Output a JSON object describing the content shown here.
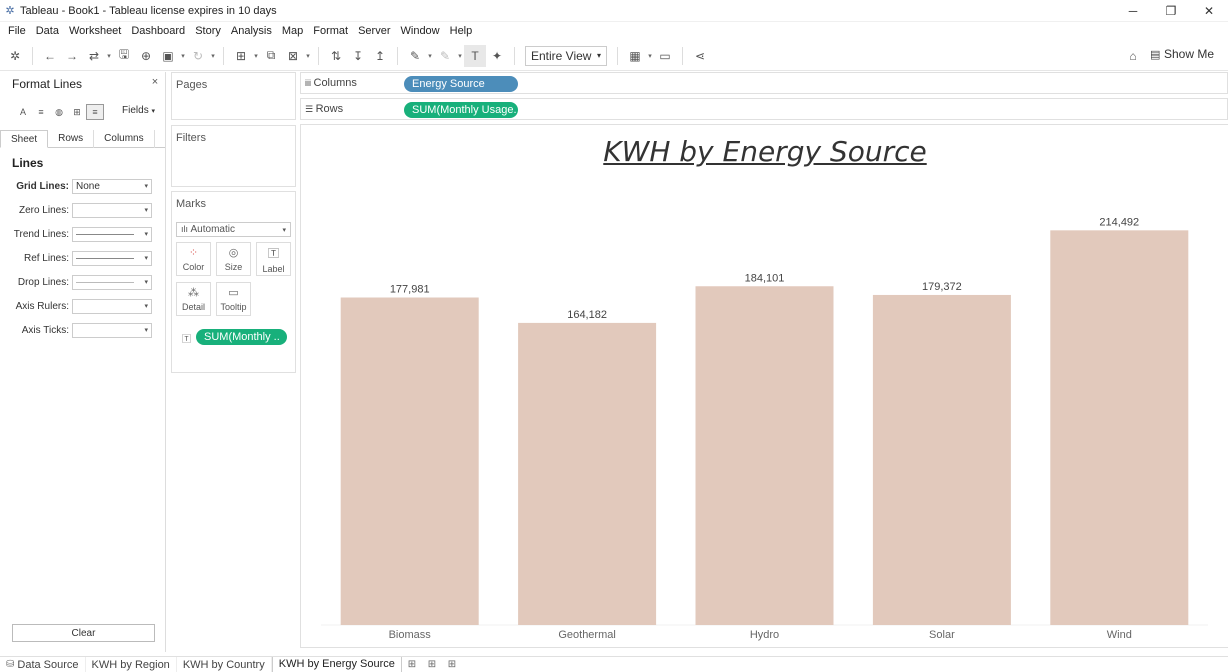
{
  "window": {
    "title": "Tableau - Book1 - Tableau license expires in 10 days",
    "controls": [
      "─",
      "❐",
      "✕"
    ]
  },
  "menu": [
    "File",
    "Data",
    "Worksheet",
    "Dashboard",
    "Story",
    "Analysis",
    "Map",
    "Format",
    "Server",
    "Window",
    "Help"
  ],
  "toolbar": {
    "view_select": "Entire View",
    "show_me": "Show Me"
  },
  "format_panel": {
    "title": "Format Lines",
    "fields_label": "Fields",
    "tabs": [
      "Sheet",
      "Rows",
      "Columns"
    ],
    "section": "Lines",
    "rows": [
      {
        "label": "Grid Lines:",
        "value": "None"
      },
      {
        "label": "Zero Lines:",
        "value": ""
      },
      {
        "label": "Trend Lines:",
        "value": ""
      },
      {
        "label": "Ref Lines:",
        "value": ""
      },
      {
        "label": "Drop Lines:",
        "value": ""
      },
      {
        "label": "Axis Rulers:",
        "value": ""
      },
      {
        "label": "Axis Ticks:",
        "value": ""
      }
    ],
    "clear_label": "Clear"
  },
  "cards": {
    "pages": "Pages",
    "filters": "Filters",
    "marks": "Marks",
    "mark_type": "Automatic",
    "buttons": [
      "Color",
      "Size",
      "Label",
      "Detail",
      "Tooltip"
    ],
    "pill": "SUM(Monthly .."
  },
  "shelves": {
    "columns_label": "Columns",
    "columns_pill": "Energy Source",
    "rows_label": "Rows",
    "rows_pill": "SUM(Monthly Usage.."
  },
  "chart_data": {
    "type": "bar",
    "title": "KWH by Energy Source",
    "categories": [
      "Biomass",
      "Geothermal",
      "Hydro",
      "Solar",
      "Wind"
    ],
    "values": [
      177981,
      164182,
      184101,
      179372,
      214492
    ],
    "labels": [
      "177,981",
      "164,182",
      "184,101",
      "179,372",
      "214,492"
    ],
    "bar_color": "#e2c9bc",
    "ylim": [
      0,
      250000
    ],
    "grid": false
  },
  "bottom_tabs": {
    "data_source": "Data Source",
    "sheets": [
      "KWH by Region",
      "KWH by Country",
      "KWH by Energy Source"
    ],
    "active": "KWH by Energy Source"
  }
}
